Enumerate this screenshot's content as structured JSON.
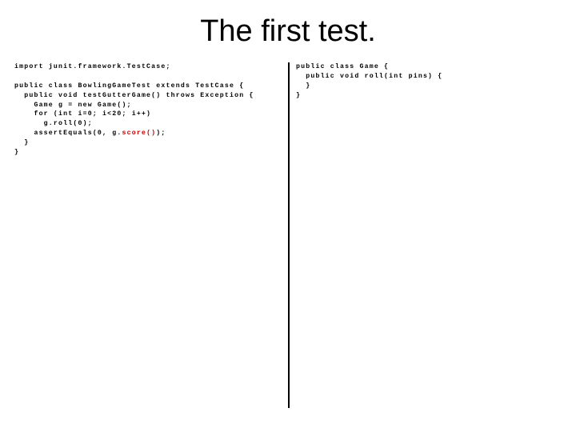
{
  "slide": {
    "title": "The first test."
  },
  "code_left": {
    "l0": "import junit.framework.TestCase;",
    "l1": "",
    "l2": "public class BowlingGameTest extends TestCase {",
    "l3": "  public void testGutterGame() throws Exception {",
    "l4": "    Game g = new Game();",
    "l5": "    for (int i=0; i<20; i++)",
    "l6": "      g.roll(0);",
    "l7a": "    assertEquals(0, g.",
    "l7b": "score()",
    "l7c": ");",
    "l8": "  }",
    "l9": "}"
  },
  "code_right": {
    "l0": "public class Game {",
    "l1": "  public void roll(int pins) {",
    "l2": "  }",
    "l3": "}"
  }
}
